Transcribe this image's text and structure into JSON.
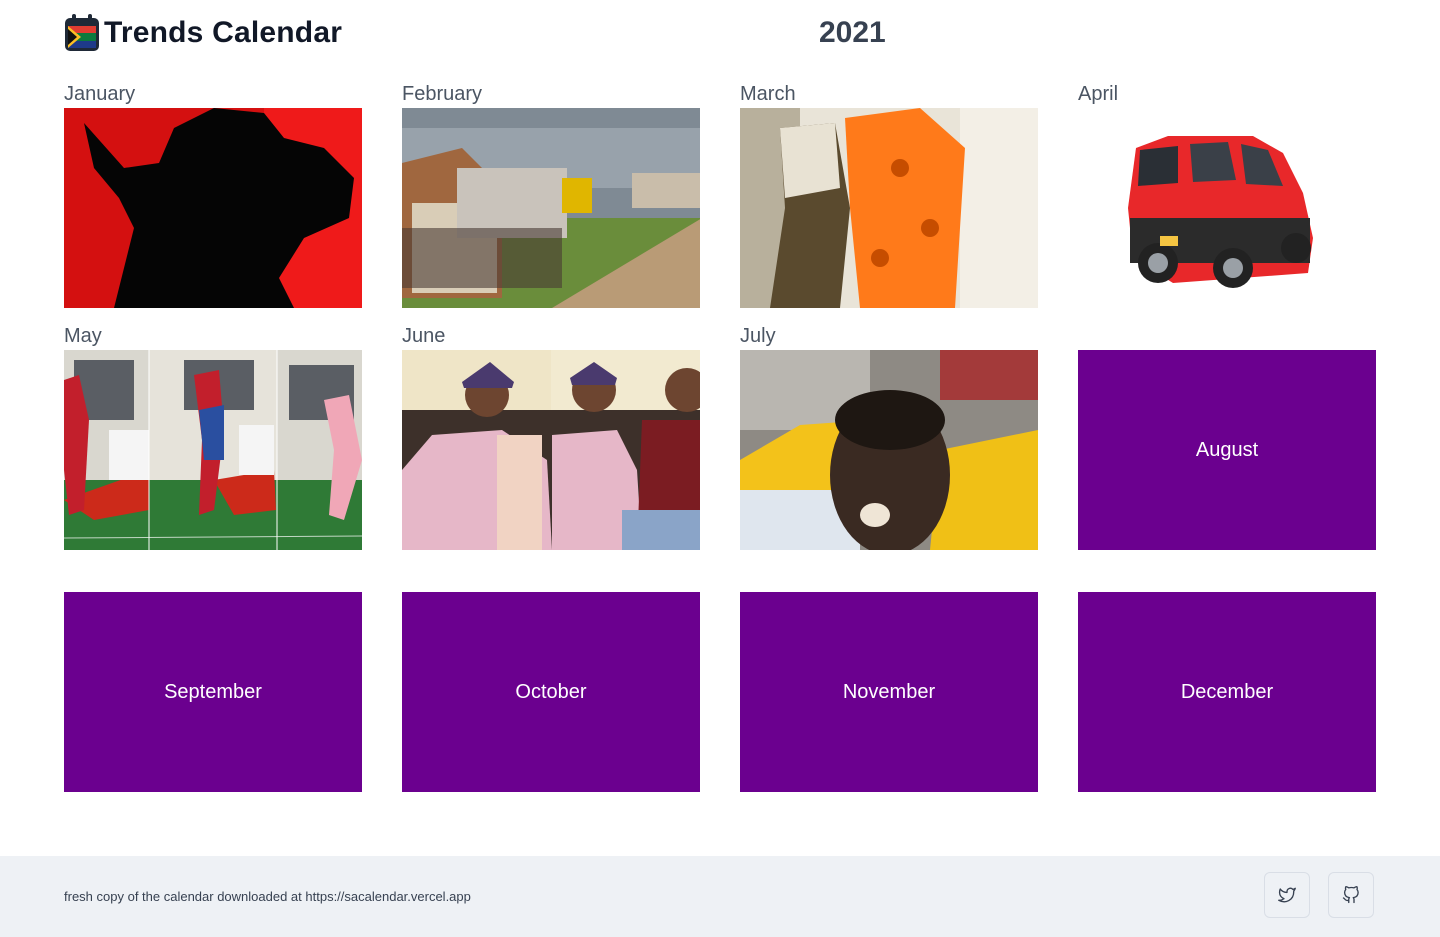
{
  "header": {
    "title": "Trends Calendar",
    "year": "2021",
    "logo_icon": "calendar-flag-icon"
  },
  "months": [
    {
      "label": "January",
      "has_image": true
    },
    {
      "label": "February",
      "has_image": true
    },
    {
      "label": "March",
      "has_image": true
    },
    {
      "label": "April",
      "has_image": true
    },
    {
      "label": "May",
      "has_image": true
    },
    {
      "label": "June",
      "has_image": true
    },
    {
      "label": "July",
      "has_image": true
    },
    {
      "label": "August",
      "has_image": false
    },
    {
      "label": "September",
      "has_image": false
    },
    {
      "label": "October",
      "has_image": false
    },
    {
      "label": "November",
      "has_image": false
    },
    {
      "label": "December",
      "has_image": false
    }
  ],
  "colors": {
    "placeholder": "#6b008f",
    "footer_bg": "#eef1f5"
  },
  "footer": {
    "text": "fresh copy of the calendar downloaded at https://sacalendar.vercel.app",
    "twitter_icon": "twitter-icon",
    "github_icon": "github-icon"
  }
}
